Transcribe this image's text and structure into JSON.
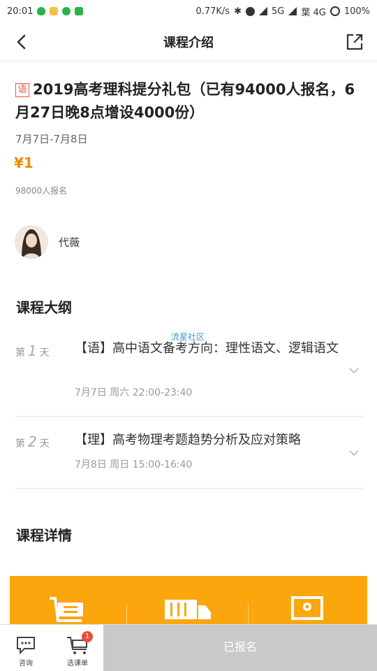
{
  "status_bar": {
    "time": "20:01",
    "network_speed": "0.77K/s",
    "carrier": "5G",
    "carrier2": "葉 4G",
    "battery": "100%"
  },
  "header": {
    "title": "课程介绍"
  },
  "course": {
    "subject_tag": "语",
    "title": "2019高考理科提分礼包（已有94000人报名，6月27日晚8点增设4000份）",
    "date_range": "7月7日-7月8日",
    "price": "¥1",
    "enrolled": "98000人报名"
  },
  "teacher": {
    "name": "代薇"
  },
  "syllabus": {
    "title": "课程大纲",
    "days": [
      {
        "prefix": "第",
        "num": "1",
        "suffix": "天",
        "lesson": "【语】高中语文备考方向：理性语文、逻辑语文",
        "time": "7月7日 周六 22:00-23:40"
      },
      {
        "prefix": "第",
        "num": "2",
        "suffix": "天",
        "lesson": "【理】高考物理考题趋势分析及应对策略",
        "time": "7月8日 周日 15:00-16:40"
      }
    ]
  },
  "watermark": "流星社区",
  "details": {
    "title": "课程详情"
  },
  "bottom_bar": {
    "consult_label": "咨询",
    "cart_label": "选课单",
    "cart_badge": "1",
    "enroll_label": "已报名"
  },
  "colors": {
    "accent": "#f08c00",
    "banner": "#fba60c",
    "badge": "#e94b3c",
    "disabled_button": "#c9c9c9"
  }
}
